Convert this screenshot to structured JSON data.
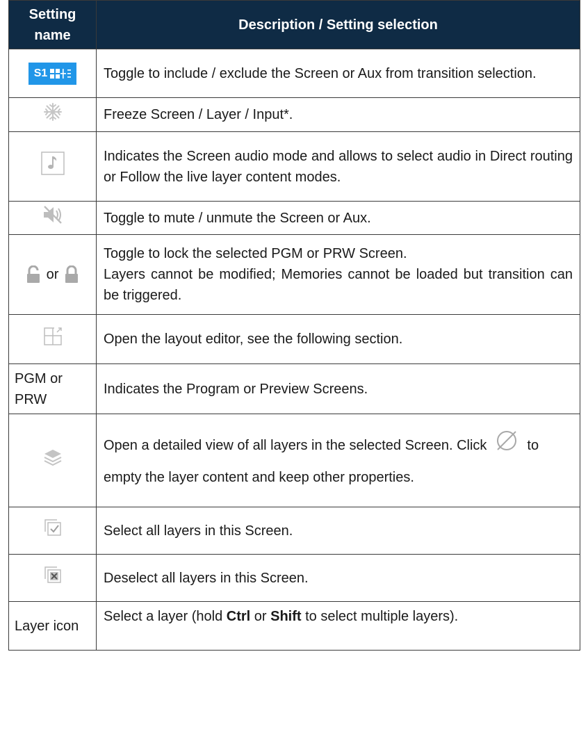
{
  "header": {
    "setting_name": "Setting name",
    "description": "Description / Setting selection"
  },
  "rows": [
    {
      "icon": "s1-screen-toggle-icon",
      "badge_text": "S1",
      "description": "Toggle to include / exclude the Screen or Aux from transition selection."
    },
    {
      "icon": "snowflake-freeze-icon",
      "description": "Freeze Screen / Layer / Input*."
    },
    {
      "icon": "audio-note-icon",
      "description": "Indicates the Screen audio mode and allows to select audio in Direct routing or Follow the live layer content modes."
    },
    {
      "icon": "mute-speaker-icon",
      "description": "Toggle to mute / unmute the Screen or Aux."
    },
    {
      "icon": "lock-icons",
      "or_text": "or",
      "description_line1": "Toggle to lock the selected PGM or PRW Screen.",
      "description_line2": "Layers cannot be modified; Memories cannot be loaded but transition can be triggered."
    },
    {
      "icon": "layout-editor-icon",
      "description": "Open the layout editor, see the following section."
    },
    {
      "name": "PGM or PRW",
      "description": "Indicates the Program or Preview Screens."
    },
    {
      "icon": "layers-stack-icon",
      "description_part1": "Open a detailed view of all layers in the selected Screen. Click",
      "empty_icon": "empty-set-icon",
      "description_part2": "to empty the layer content and keep other properties."
    },
    {
      "icon": "select-all-layers-icon",
      "description": "Select all layers in this Screen."
    },
    {
      "icon": "deselect-all-layers-icon",
      "description": "Deselect all layers in this Screen."
    },
    {
      "name": "Layer icon",
      "description_prefix": "Select a layer (hold ",
      "key1": "Ctrl",
      "description_mid": " or ",
      "key2": "Shift",
      "description_suffix": " to select multiple layers)."
    }
  ],
  "colors": {
    "header_bg": "#0f2b45",
    "badge_bg": "#2196e8",
    "icon_gray": "#b9b9b9"
  }
}
